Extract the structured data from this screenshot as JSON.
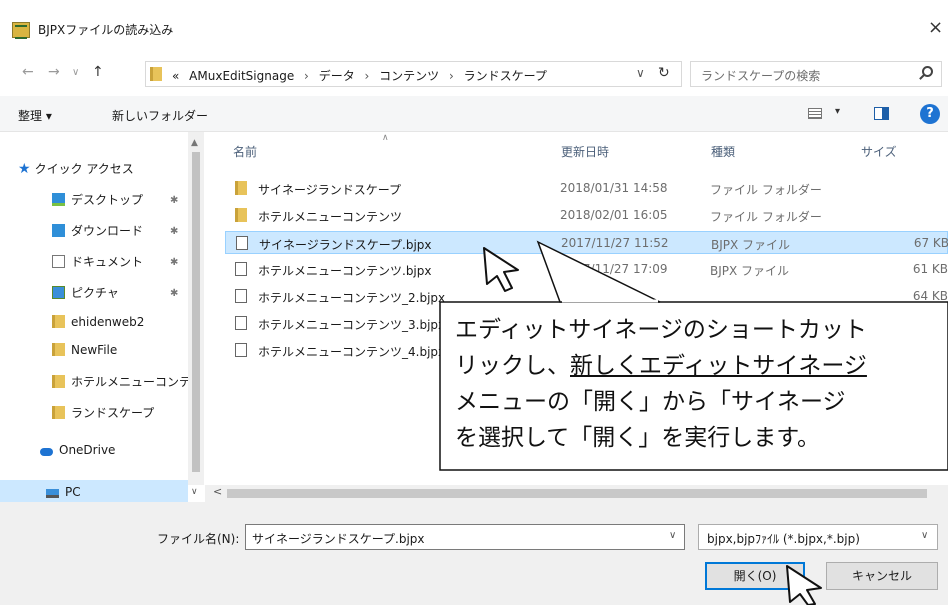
{
  "window": {
    "title": "BJPXファイルの読み込み",
    "close_glyph": "×"
  },
  "address": {
    "back_glyph": "←",
    "forward_glyph": "→",
    "recent_glyph": "∨",
    "up_glyph": "↑",
    "overflow": "«",
    "crumbs": [
      "AMuxEditSignage",
      "データ",
      "コンテンツ",
      "ランドスケープ"
    ],
    "separator": "›",
    "dropdown_glyph": "∨",
    "refresh_glyph": "↻",
    "search_placeholder": "ランドスケープの検索"
  },
  "toolbar": {
    "organize": "整理 ▾",
    "new_folder": "新しいフォルダー",
    "view_drop_glyph": "▾",
    "help": "?"
  },
  "nav": {
    "quick_access": "クイック アクセス",
    "items": [
      {
        "label": "デスクトップ",
        "icon": "desktop-icon",
        "pinned": true
      },
      {
        "label": "ダウンロード",
        "icon": "download-icon",
        "pinned": true
      },
      {
        "label": "ドキュメント",
        "icon": "document-icon",
        "pinned": true
      },
      {
        "label": "ピクチャ",
        "icon": "pictures-icon",
        "pinned": true
      },
      {
        "label": "ehidenweb2",
        "icon": "folder-icon",
        "pinned": false
      },
      {
        "label": "NewFile",
        "icon": "folder-icon",
        "pinned": false
      },
      {
        "label": "ホテルメニューコンテ",
        "icon": "folder-icon",
        "pinned": false
      },
      {
        "label": "ランドスケープ",
        "icon": "folder-icon",
        "pinned": false
      }
    ],
    "onedrive": "OneDrive",
    "pc": "PC",
    "pin_glyph": "✱"
  },
  "columns": {
    "name": "名前",
    "modified": "更新日時",
    "type": "種類",
    "size": "サイズ"
  },
  "files": [
    {
      "name": "サイネージランドスケープ",
      "date": "2018/01/31 14:58",
      "type": "ファイル フォルダー",
      "size": "",
      "kind": "folder",
      "selected": false
    },
    {
      "name": "ホテルメニューコンテンツ",
      "date": "2018/02/01 16:05",
      "type": "ファイル フォルダー",
      "size": "",
      "kind": "folder",
      "selected": false
    },
    {
      "name": "サイネージランドスケープ.bjpx",
      "date": "2017/11/27 11:52",
      "type": "BJPX ファイル",
      "size": "67 KB",
      "kind": "file",
      "selected": true
    },
    {
      "name": "ホテルメニューコンテンツ.bjpx",
      "date": "2017/11/27 17:09",
      "type": "BJPX ファイル",
      "size": "61 KB",
      "kind": "file",
      "selected": false
    },
    {
      "name": "ホテルメニューコンテンツ_2.bjpx",
      "date": "",
      "type": "",
      "size": "64 KB",
      "kind": "file",
      "selected": false
    },
    {
      "name": "ホテルメニューコンテンツ_3.bjpx",
      "date": "",
      "type": "",
      "size": "",
      "kind": "file",
      "selected": false
    },
    {
      "name": "ホテルメニューコンテンツ_4.bjpx",
      "date": "",
      "type": "",
      "size": "",
      "kind": "file",
      "selected": false
    }
  ],
  "footer": {
    "filename_label": "ファイル名(N):",
    "filename_value": "サイネージランドスケープ.bjpx",
    "filter_value": "bjpx,bjpﾌｧｲﾙ (*.bjpx,*.bjp)",
    "open_button": "開く(O)",
    "cancel_button": "キャンセル"
  },
  "callout": {
    "line1": "エディットサイネージのショートカット",
    "line2_a": "リックし、",
    "line2_b": "新しくエディットサイネージ",
    "line3": "メニューの「開く」から「サイネージ",
    "line4": "を選択して「開く」を実行します。"
  },
  "colors": {
    "selection": "#cce8ff",
    "accent": "#0078d7",
    "folder": "#e8c35a"
  }
}
